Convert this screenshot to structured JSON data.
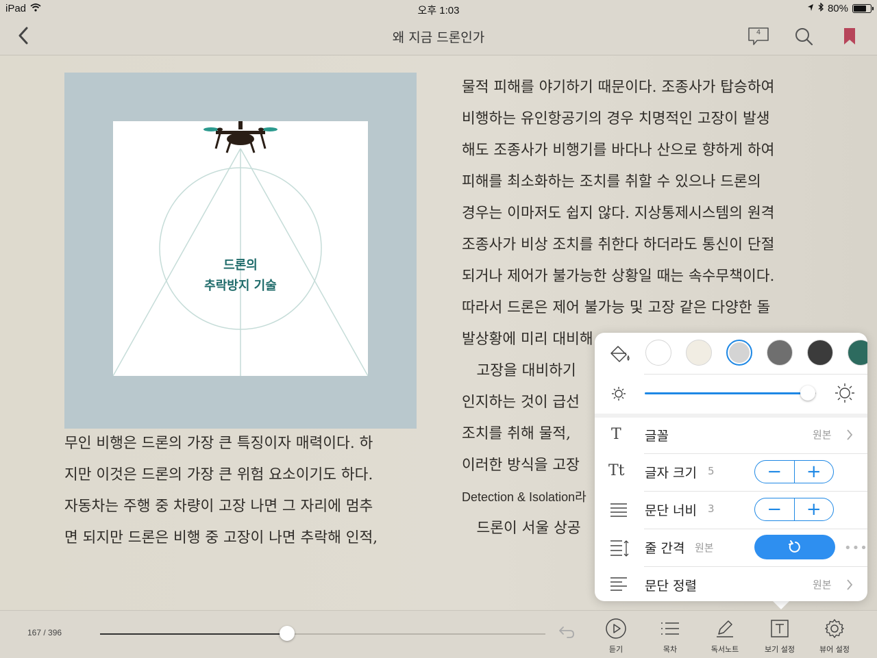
{
  "status_bar": {
    "device": "iPad",
    "time": "오후 1:03",
    "battery": "80%",
    "battery_level": 0.8
  },
  "nav": {
    "title": "왜 지금 드론인가",
    "notes_count": "4"
  },
  "figure": {
    "line1": "드론의",
    "line2": "추락방지 기술"
  },
  "left_column": [
    "무인 비행은 드론의 가장 큰 특징이자 매력이다. 하",
    "지만 이것은 드론의 가장 큰 위험 요소이기도 하다.",
    "자동차는 주행 중 차량이 고장 나면 그 자리에 멈추",
    "면 되지만 드론은 비행 중 고장이 나면 추락해 인적,"
  ],
  "right_column": [
    "물적 피해를 야기하기 때문이다. 조종사가 탑승하여",
    "비행하는 유인항공기의 경우 치명적인 고장이 발생",
    "해도 조종사가 비행기를 바다나 산으로 향하게 하여",
    "피해를 최소화하는 조치를 취할 수 있으나 드론의",
    "경우는 이마저도 쉽지 않다. 지상통제시스템의 원격",
    "조종사가 비상 조치를 취한다 하더라도 통신이 단절",
    "되거나 제어가 불가능한 상황일 때는 속수무책이다.",
    "따라서 드론은 제어 불가능 및 고장 같은 다양한 돌",
    "발상황에 미리 대비해",
    "　고장을 대비하기",
    "인지하는 것이 급선",
    "조치를 취해 물적,",
    "이러한 방식을 고장",
    "Detection & Isolation라",
    "　드론이 서울 상공"
  ],
  "toolbar": {
    "page_indicator": "167 / 396",
    "progress": 0.42,
    "tools": [
      {
        "label": "듣기"
      },
      {
        "label": "목차"
      },
      {
        "label": "독서노트"
      },
      {
        "label": "보기 설정"
      },
      {
        "label": "뷰어 설정"
      }
    ]
  },
  "popover": {
    "themes": [
      {
        "color": "#ffffff",
        "selected": false
      },
      {
        "color": "#f1ede3",
        "selected": false
      },
      {
        "color": "#d4d4d4",
        "selected": true
      },
      {
        "color": "#6f6f6f",
        "selected": false
      },
      {
        "color": "#3b3b3b",
        "selected": false
      },
      {
        "color": "#2d6b5f",
        "selected": false
      }
    ],
    "brightness": 0.95,
    "font": {
      "label": "글꼴",
      "value": "원본"
    },
    "font_size": {
      "label": "글자 크기",
      "value": "5"
    },
    "paragraph_width": {
      "label": "문단 너비",
      "value": "3"
    },
    "line_spacing": {
      "label": "줄 간격",
      "value": "원본"
    },
    "alignment": {
      "label": "문단 정렬",
      "value": "원본"
    },
    "accent": "#1e88e5"
  }
}
